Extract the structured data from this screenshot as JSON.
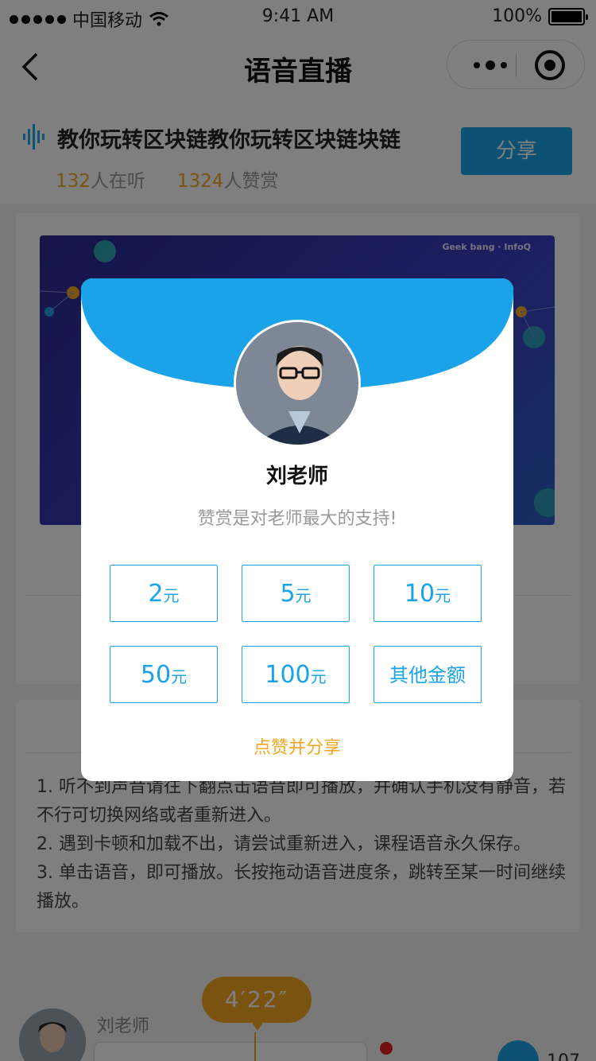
{
  "status_bar": {
    "carrier": "中国移动",
    "time": "9:41 AM",
    "battery": "100%"
  },
  "nav": {
    "title": "语音直播"
  },
  "course": {
    "title": "教你玩转区块链教你玩转区块链块链",
    "listeners_num": "132",
    "listeners_label": "人在听",
    "likes_num": "1324",
    "likes_label": "人赞赏",
    "share_label": "分享"
  },
  "banner": {
    "logo_text": "Geek bang · InfoQ"
  },
  "tips": {
    "items": [
      "1. 听不到声音请往下翻点击语音即可播放，并确认手机没有静音，若不行可切换网络或者重新进入。",
      "2. 遇到卡顿和加载不出，请尝试重新进入，课程语音永久保存。",
      "3. 单击语音，即可播放。长按拖动语音进度条，跳转至某一时间继续播放。"
    ]
  },
  "player": {
    "duration": "4′22″",
    "speaker": "刘老师",
    "like_count": "107"
  },
  "reward_modal": {
    "teacher_name": "刘老师",
    "subtitle": "赞赏是对老师最大的支持!",
    "currency": "元",
    "amounts": [
      "2",
      "5",
      "10",
      "50",
      "100"
    ],
    "other_label": "其他金额",
    "like_share_label": "点赞并分享"
  },
  "colors": {
    "accent": "#1aa3e8",
    "highlight": "#f5a623"
  }
}
